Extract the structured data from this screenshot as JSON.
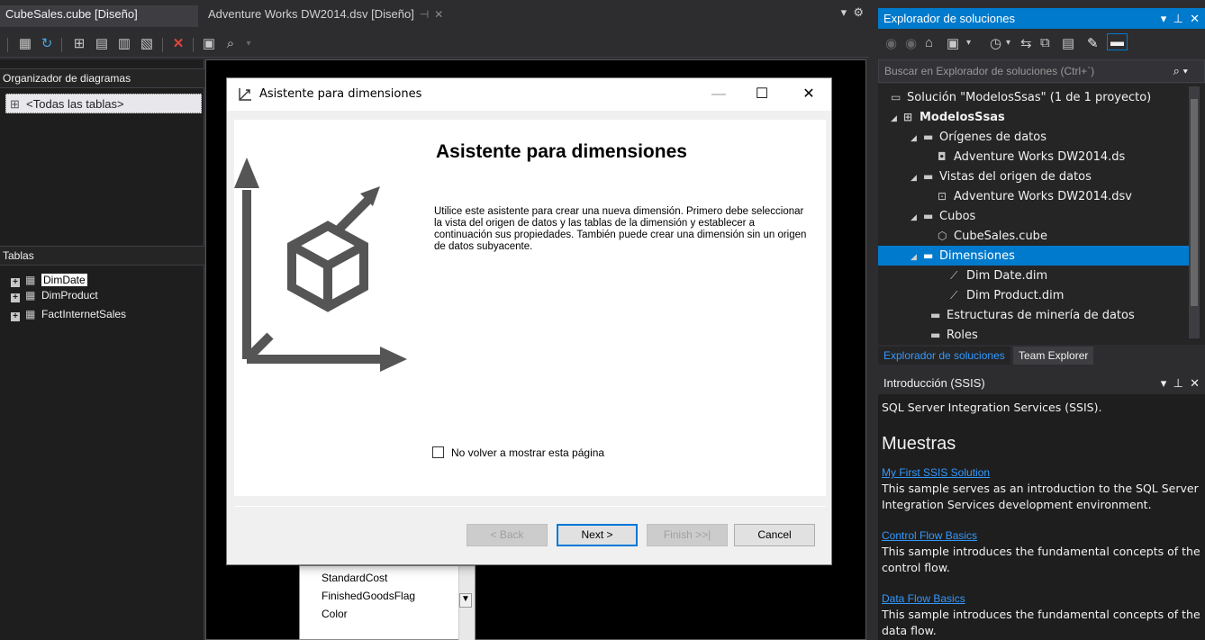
{
  "doc_tabs": {
    "active": "CubeSales.cube [Diseño]",
    "second": "Adventure Works DW2014.dsv [Diseño]"
  },
  "left": {
    "diagram_header": "Organizador de diagramas",
    "diagram_item": "<Todas las tablas>",
    "tables_header": "Tablas",
    "tables": [
      "DimDate",
      "DimProduct",
      "FactInternetSales"
    ]
  },
  "column_list": [
    "StandardCost",
    "FinishedGoodsFlag",
    "Color"
  ],
  "dialog": {
    "title": "Asistente para dimensiones",
    "heading": "Asistente para dimensiones",
    "description": "Utilice este asistente para crear una nueva dimensión. Primero debe seleccionar la vista del origen de datos y las tablas de la dimensión y establecer a continuación sus propiedades. También puede crear una dimensión sin un origen de datos subyacente.",
    "checkbox": "No volver a mostrar esta página",
    "back": "< Back",
    "next": "Next >",
    "finish": "Finish >>|",
    "cancel": "Cancel"
  },
  "solution_explorer": {
    "title": "Explorador de soluciones",
    "search_placeholder": "Buscar en Explorador de soluciones (Ctrl+`)",
    "nodes": {
      "solution": "Solución \"ModelosSsas\" (1 de 1 proyecto)",
      "project": "ModelosSsas",
      "datasources": "Orígenes de datos",
      "ds_file": "Adventure Works DW2014.ds",
      "dsv": "Vistas del origen de datos",
      "dsv_file": "Adventure Works DW2014.dsv",
      "cubes": "Cubos",
      "cube_file": "CubeSales.cube",
      "dimensions": "Dimensiones",
      "dim_date": "Dim Date.dim",
      "dim_product": "Dim Product.dim",
      "mining": "Estructuras de minería de datos",
      "roles": "Roles"
    },
    "tab_active": "Explorador de soluciones",
    "tab_inactive": "Team Explorer"
  },
  "intro": {
    "title": "Introducción (SSIS)",
    "subtitle": "SQL Server Integration Services (SSIS).",
    "heading": "Muestras",
    "items": [
      {
        "link": "My First SSIS Solution",
        "text": "This sample serves as an introduction to the SQL Server Integration Services development environment."
      },
      {
        "link": "Control Flow Basics",
        "text": "This sample introduces the fundamental concepts of the control flow."
      },
      {
        "link": "Data Flow Basics",
        "text": "This sample introduces the fundamental concepts of the data flow."
      }
    ]
  },
  "colors": {
    "accent": "#007acc",
    "dark_bg": "#1e1e1e",
    "dialog_bg": "#f0f0f0"
  }
}
